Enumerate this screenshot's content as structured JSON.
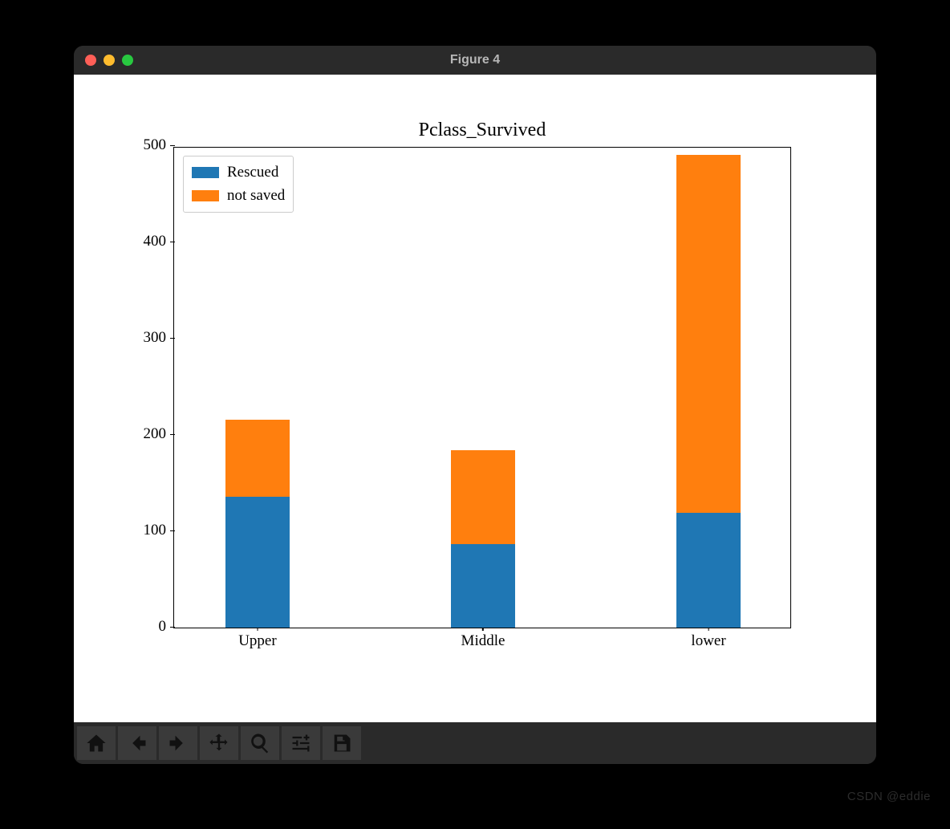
{
  "window": {
    "title": "Figure 4"
  },
  "toolbar": {
    "home": "Home",
    "back": "Back",
    "forward": "Forward",
    "pan": "Pan",
    "zoom": "Zoom",
    "configure": "Configure subplots",
    "save": "Save"
  },
  "chart_data": {
    "type": "bar",
    "stacked": true,
    "title": "Pclass_Survived",
    "xlabel": "",
    "ylabel": "",
    "categories": [
      "Upper",
      "Middle",
      "lower"
    ],
    "series": [
      {
        "name": "Rescued",
        "color": "#1f77b4",
        "values": [
          136,
          87,
          119
        ]
      },
      {
        "name": "not saved",
        "color": "#ff7f0e",
        "values": [
          80,
          97,
          372
        ]
      }
    ],
    "ylim": [
      0,
      500
    ],
    "yticks": [
      0,
      100,
      200,
      300,
      400,
      500
    ],
    "legend_position": "upper left"
  },
  "watermark": "CSDN @eddie"
}
